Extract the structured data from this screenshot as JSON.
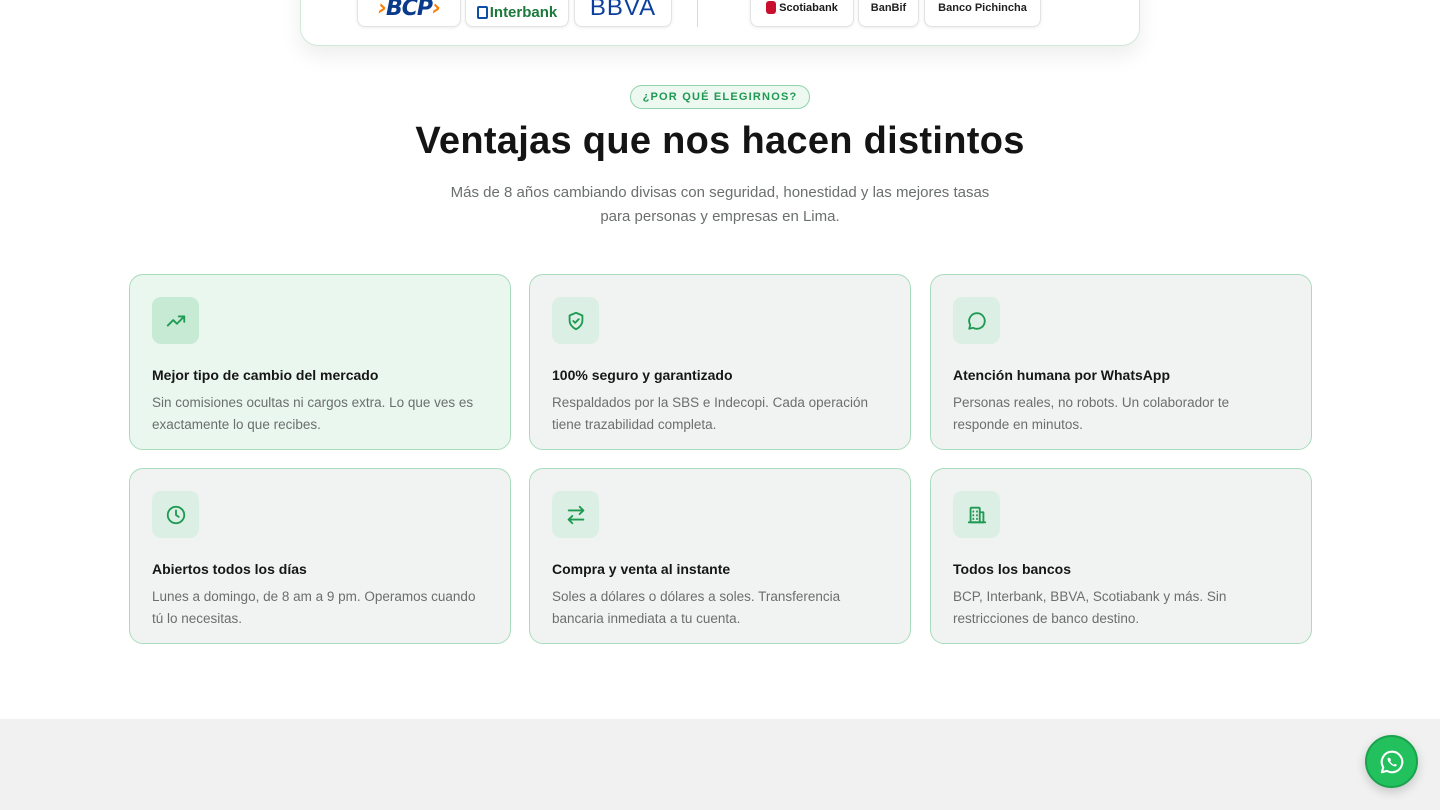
{
  "banks": {
    "primary": [
      {
        "name": "BCP",
        "logo_text": "BCP"
      },
      {
        "name": "Interbank",
        "logo_text": "Interbank"
      },
      {
        "name": "BBVA",
        "logo_text": "BBVA"
      }
    ],
    "secondary": [
      {
        "name": "Scotiabank",
        "logo_text": "Scotiabank"
      },
      {
        "name": "BanBif",
        "logo_text": "BanBif"
      },
      {
        "name": "Banco Pichincha",
        "logo_text": "Banco Pichincha"
      }
    ]
  },
  "section": {
    "eyebrow": "¿POR QUÉ ELEGIRNOS?",
    "title": "Ventajas que nos hacen distintos",
    "subtitle": "Más de 8 años cambiando divisas con seguridad, honestidad y las mejores tasas para personas y empresas en Lima."
  },
  "features": [
    {
      "icon": "trending-up-icon",
      "title": "Mejor tipo de cambio del mercado",
      "desc": "Sin comisiones ocultas ni cargos extra. Lo que ves es exactamente lo que recibes."
    },
    {
      "icon": "shield-check-icon",
      "title": "100% seguro y garantizado",
      "desc": "Respaldados por la SBS e Indecopi. Cada operación tiene trazabilidad completa."
    },
    {
      "icon": "chat-bubble-icon",
      "title": "Atención humana por WhatsApp",
      "desc": "Personas reales, no robots. Un colaborador te responde en minutos."
    },
    {
      "icon": "clock-icon",
      "title": "Abiertos todos los días",
      "desc": "Lunes a domingo, de 8 am a 9 pm. Operamos cuando tú lo necesitas."
    },
    {
      "icon": "arrows-exchange-icon",
      "title": "Compra y venta al instante",
      "desc": "Soles a dólares o dólares a soles. Transferencia bancaria inmediata a tu cuenta."
    },
    {
      "icon": "bank-building-icon",
      "title": "Todos los bancos",
      "desc": "BCP, Interbank, BBVA, Scotiabank y más. Sin restricciones de banco destino."
    }
  ],
  "colors": {
    "accent": "#1f9a52",
    "card_border": "#a9dcbd",
    "whatsapp": "#22c15e"
  }
}
